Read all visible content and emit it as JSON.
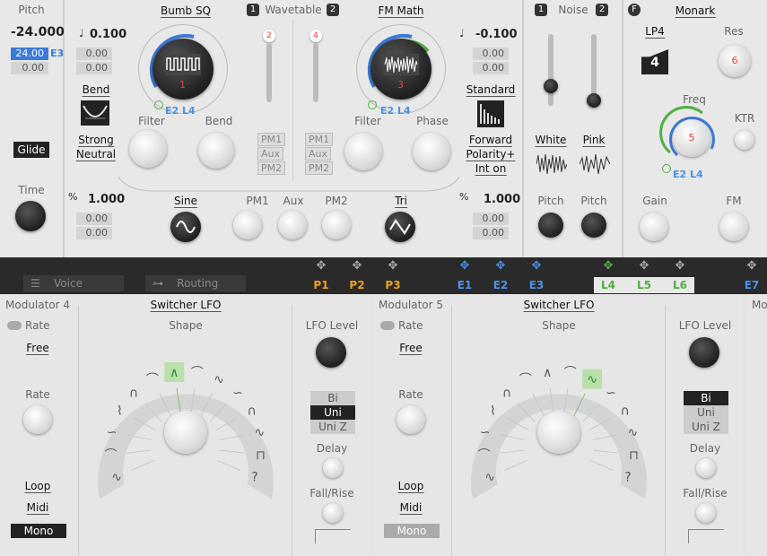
{
  "pitch": {
    "label": "Pitch",
    "value": "-24.000",
    "boxes": [
      "24.00",
      "0.00"
    ],
    "mod": "E3",
    "glide": "Glide",
    "time": "Time"
  },
  "osc1": {
    "name": "Bumb SQ",
    "num": "1",
    "coarse": "0.100",
    "boxes": [
      "0.00",
      "0.00"
    ],
    "bend": "Bend",
    "mode1": "Strong",
    "mode2": "Neutral",
    "filter": "Filter",
    "bend_knob": "Bend",
    "mods": "E2 L4",
    "slider_num": "2",
    "fine": "1.000",
    "fine_boxes": [
      "0.00",
      "0.00"
    ],
    "shape": "Sine",
    "pm": [
      "PM1",
      "Aux",
      "PM2"
    ]
  },
  "wavetable": {
    "label": "Wavetable",
    "a": "1",
    "b": "2"
  },
  "osc2": {
    "name": "FM Math",
    "num": "3",
    "coarse": "-0.100",
    "boxes": [
      "0.00",
      "0.00"
    ],
    "mode": "Standard",
    "m1": "Forward",
    "m2": "Polarity+",
    "m3": "Int on",
    "filter": "Filter",
    "phase": "Phase",
    "mods": "E2 L4",
    "slider_num": "4",
    "fine": "1.000",
    "fine_boxes": [
      "0.00",
      "0.00"
    ],
    "shape": "Tri",
    "pm": [
      "PM1",
      "Aux",
      "PM2"
    ]
  },
  "mid": {
    "pm1": "PM1",
    "aux": "Aux",
    "pm2": "PM2"
  },
  "noise": {
    "label": "Noise",
    "a": "1",
    "b": "2",
    "white": "White",
    "pink": "Pink",
    "pitch": "Pitch"
  },
  "filter": {
    "badge": "F",
    "name": "Monark",
    "type": "LP4",
    "type_num": "4",
    "res": "Res",
    "res_num": "6",
    "freq": "Freq",
    "freq_num": "5",
    "ktr": "KTR",
    "mods": "E2 L4",
    "gain": "Gain",
    "fm": "FM"
  },
  "tabs": {
    "voice": "Voice",
    "routing": "Routing"
  },
  "modulators": [
    {
      "label": "P1",
      "color": "#f0a020"
    },
    {
      "label": "P2",
      "color": "#f0a020"
    },
    {
      "label": "P3",
      "color": "#f0a020"
    },
    {
      "label": "E1",
      "color": "#4a90e8"
    },
    {
      "label": "E2",
      "color": "#4a90e8"
    },
    {
      "label": "E3",
      "color": "#4a90e8"
    },
    {
      "label": "L4",
      "color": "#50b040"
    },
    {
      "label": "L5",
      "color": "#50b040"
    },
    {
      "label": "L6",
      "color": "#50b040"
    },
    {
      "label": "E7",
      "color": "#4a90e8"
    }
  ],
  "mod4": {
    "title": "Modulator 4",
    "rate_mode": "Rate",
    "free": "Free",
    "type": "Switcher LFO",
    "shape": "Shape",
    "lfo_level": "LFO Level",
    "rate": "Rate",
    "seg": [
      "Bi",
      "Uni",
      "Uni Z"
    ],
    "delay": "Delay",
    "fall": "Fall/Rise",
    "loop": "Loop",
    "midi": "Midi",
    "mono": "Mono"
  },
  "mod5": {
    "title": "Modulator 5",
    "rate_mode": "Rate",
    "free": "Free",
    "type": "Switcher LFO",
    "shape": "Shape",
    "lfo_level": "LFO Level",
    "rate": "Rate",
    "seg": [
      "Bi",
      "Uni",
      "Uni Z"
    ],
    "delay": "Delay",
    "fall": "Fall/Rise",
    "loop": "Loop",
    "midi": "Midi",
    "mono": "Mono"
  },
  "mod6": {
    "title": "Mo"
  }
}
